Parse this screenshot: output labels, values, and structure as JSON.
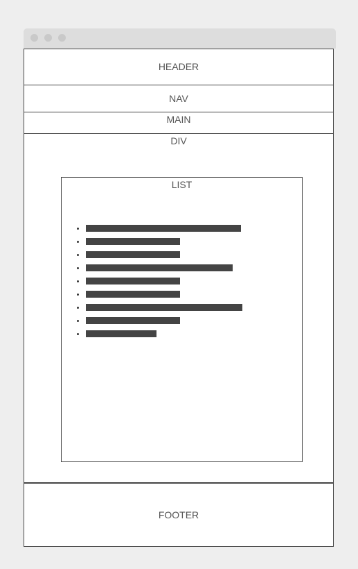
{
  "browser": {
    "window_dots": [
      "close",
      "minimize",
      "maximize"
    ]
  },
  "sections": {
    "header": "HEADER",
    "nav": "NAV",
    "main": "MAIN",
    "div": "DIV",
    "footer": "FOOTER"
  },
  "list": {
    "label": "LIST",
    "items": [
      {
        "relative_length": 0.99
      },
      {
        "relative_length": 0.6
      },
      {
        "relative_length": 0.6
      },
      {
        "relative_length": 0.94
      },
      {
        "relative_length": 0.6
      },
      {
        "relative_length": 0.6
      },
      {
        "relative_length": 1.0
      },
      {
        "relative_length": 0.6
      },
      {
        "relative_length": 0.45
      }
    ]
  },
  "colors": {
    "background": "#eeeeee",
    "titlebar": "#dddddd",
    "border": "#444444",
    "text": "#555555",
    "placeholder_bar": "#444444"
  }
}
